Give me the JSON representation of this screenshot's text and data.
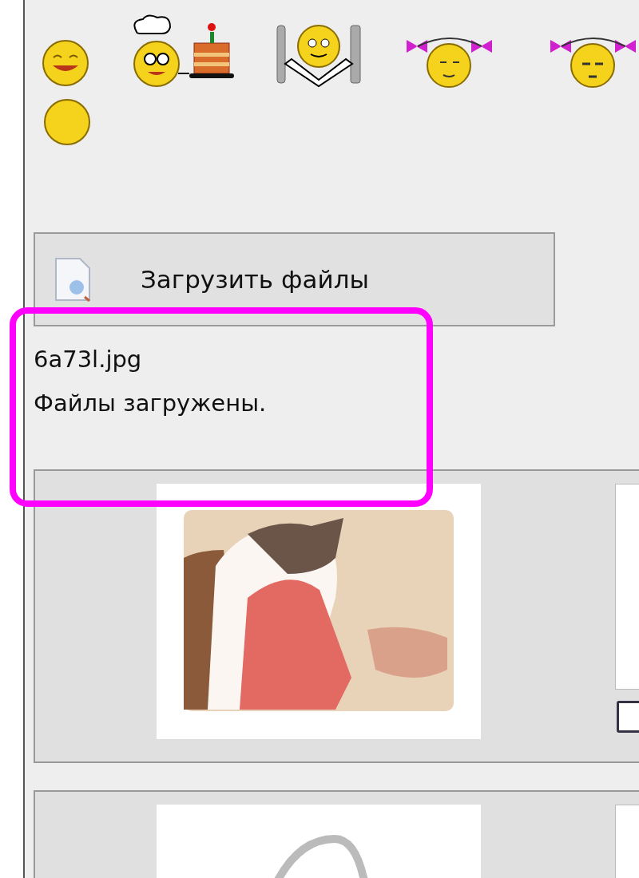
{
  "upload_button": {
    "label": "Загрузить файлы"
  },
  "upload_status": {
    "lines": [
      "6a73l.jpg",
      "Файлы загружены."
    ],
    "highlighted": true
  },
  "attachments": [
    {
      "kind": "photo",
      "checkbox": {
        "checked": false
      }
    },
    {
      "kind": "clip"
    }
  ]
}
